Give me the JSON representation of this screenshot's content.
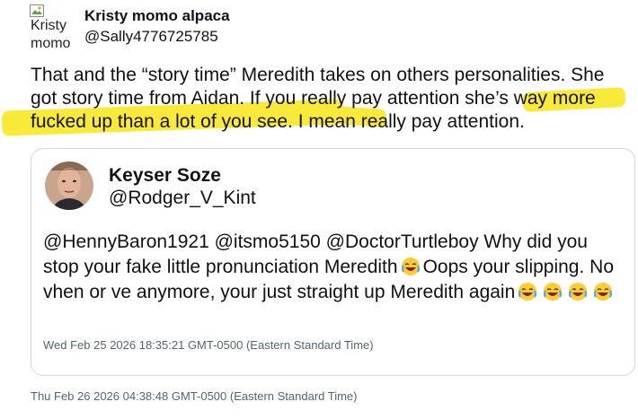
{
  "author": {
    "name": "Kristy momo alpaca",
    "handle": "@Sally4776725785",
    "avatar_alt": "Kristy momo"
  },
  "post": {
    "text_part1": "That and the “story time” Meredith takes on others personalities. She got story time from Aidan. If you really pay attention she’s way more fucked up than a lot of you see. I mean really pay attention.",
    "timestamp": "Thu Feb 26 2026 04:38:48 GMT-0500 (Eastern Standard Time)"
  },
  "quoted": {
    "name": "Keyser Soze",
    "handle": "@Rodger_V_Kint",
    "text_before_emoji": "@HennyBaron1921 @itsmo5150 @DoctorTurtleboy Why did you stop your fake little pronunciation Meredith",
    "text_after_emoji": "Oops your slipping. No vhen or ve anymore, your just straight up Meredith again",
    "emoji_name": "face-with-tears-of-joy-icon",
    "timestamp": "Wed Feb 25 2026 18:35:21 GMT-0500 (Eastern Standard Time)"
  },
  "colors": {
    "highlight": "#f9ea3a",
    "card_border": "#cfd9de",
    "timestamp": "#536471"
  }
}
